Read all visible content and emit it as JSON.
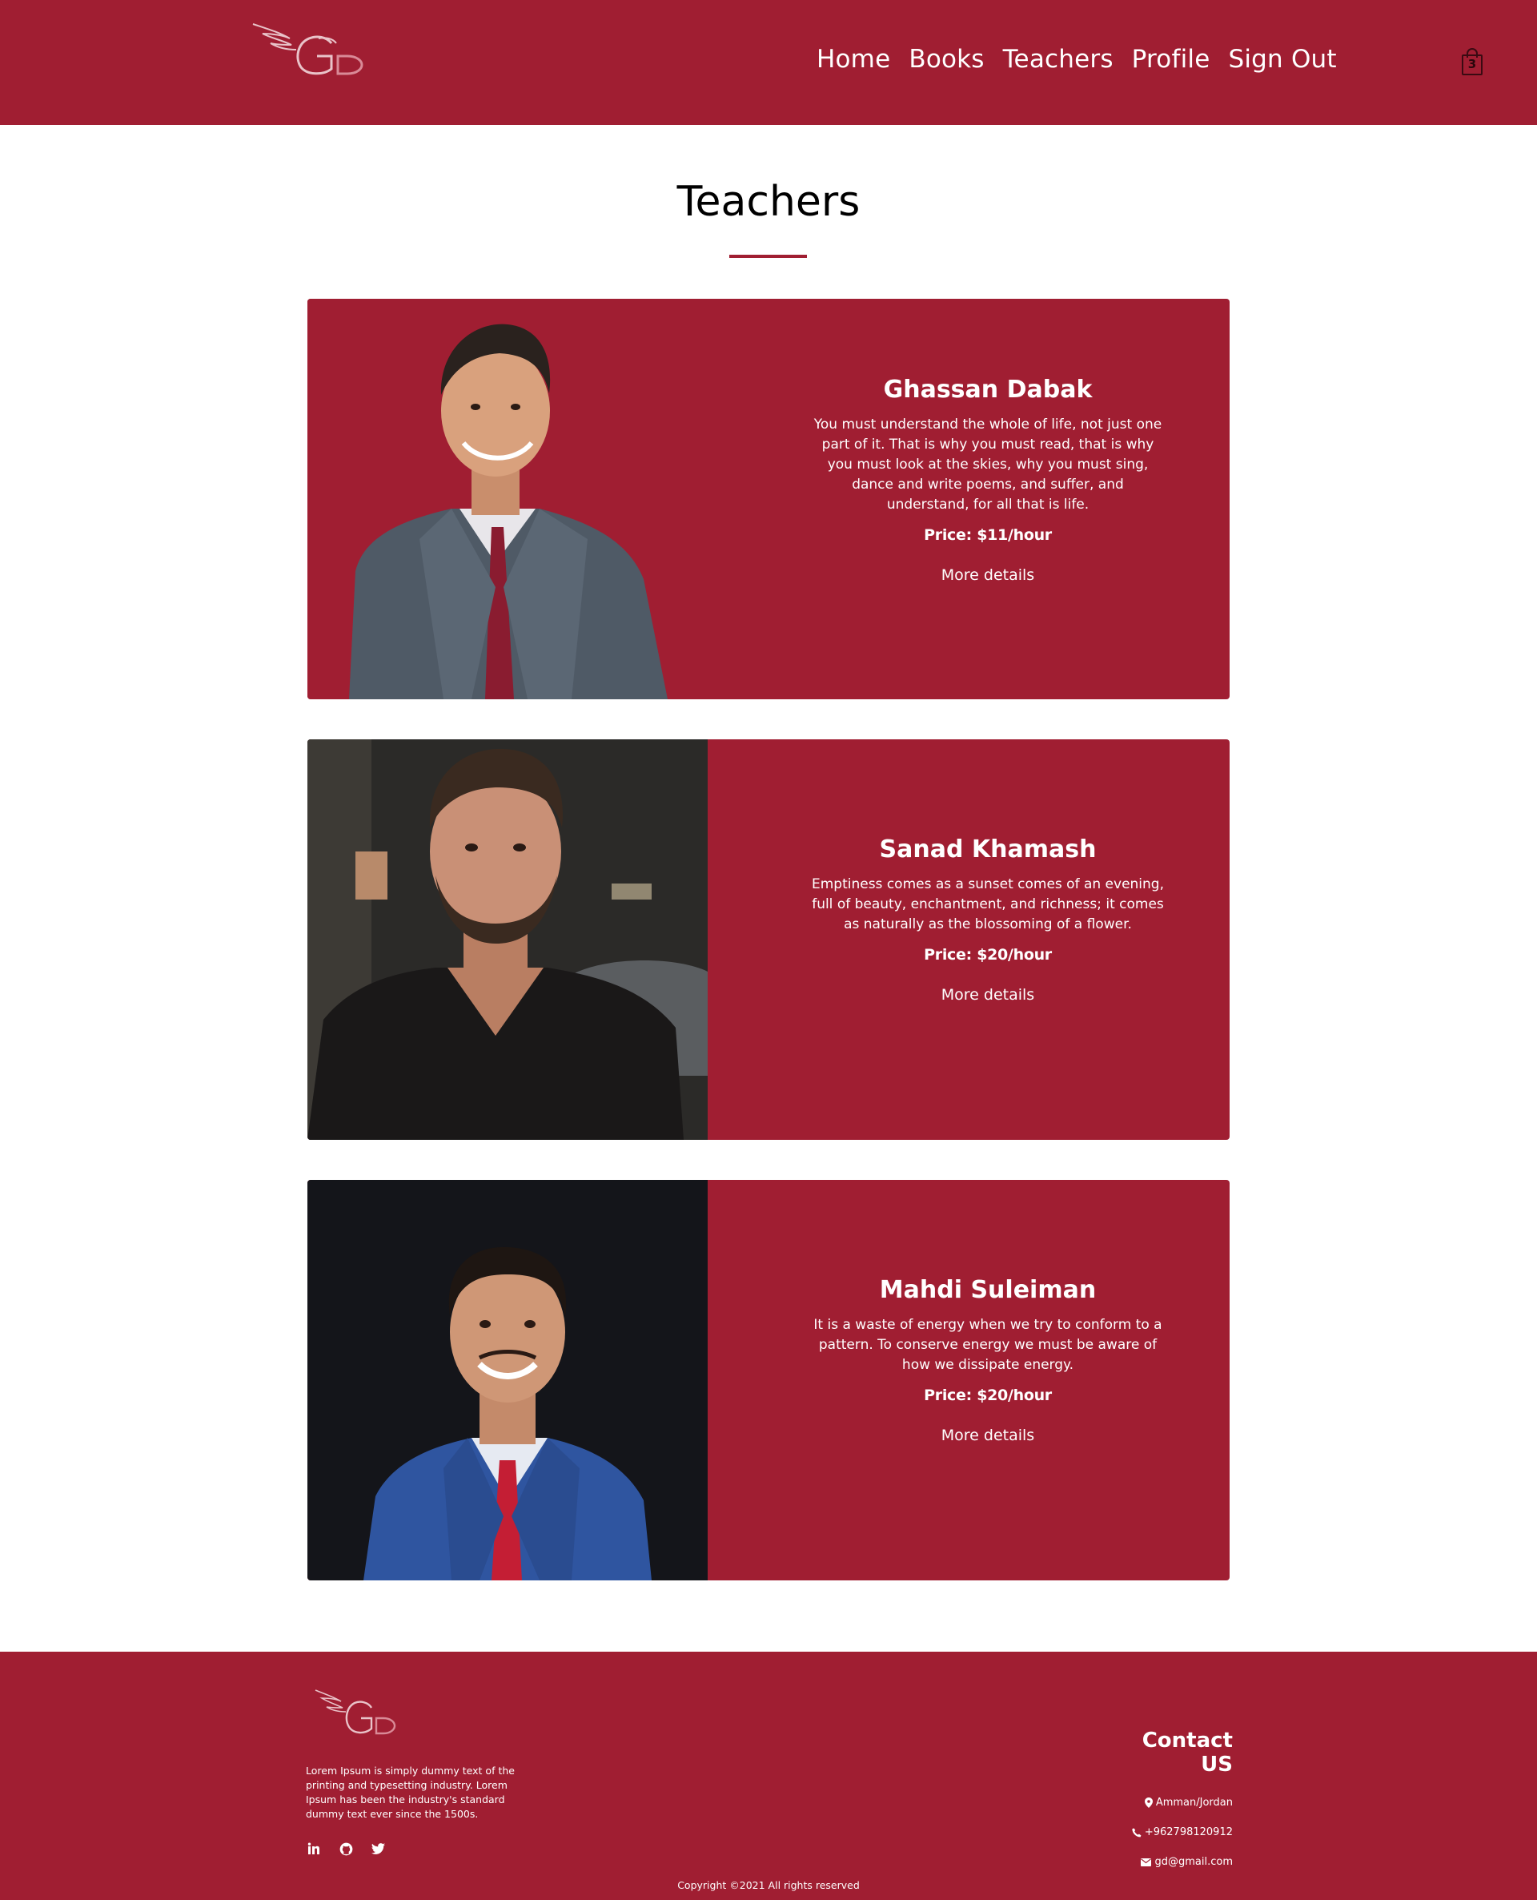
{
  "nav": {
    "links": [
      "Home",
      "Books",
      "Teachers",
      "Profile",
      "Sign Out"
    ],
    "cart_count": "3",
    "logo_icon": "gd-winged-logo"
  },
  "page": {
    "title": "Teachers"
  },
  "teachers": [
    {
      "name": "Ghassan Dabak",
      "quote": "You must understand the whole of life, not just one part of it. That is why you must read, that is why you must look at the skies, why you must sing, dance and write poems, and suffer, and understand, for all that is life.",
      "price": "Price: $11/hour",
      "more": "More details"
    },
    {
      "name": "Sanad Khamash",
      "quote": "Emptiness comes as a sunset comes of an evening, full of beauty, enchantment, and richness; it comes as naturally as the blossoming of a flower.",
      "price": "Price: $20/hour",
      "more": "More details"
    },
    {
      "name": "Mahdi Suleiman",
      "quote": "It is a waste of energy when we try to conform to a pattern. To conserve energy we must be aware of how we dissipate energy.",
      "price": "Price: $20/hour",
      "more": "More details"
    }
  ],
  "footer": {
    "about": "Lorem Ipsum is simply dummy text of the printing and typesetting industry. Lorem Ipsum has been the industry's standard dummy text ever since the 1500s.",
    "social": [
      "linkedin-icon",
      "github-icon",
      "twitter-icon"
    ],
    "contact_title": "Contact US",
    "location": "Amman/Jordan",
    "phone": "+962798120912",
    "email": "gd@gmail.com",
    "copyright": "Copyright ©2021 All rights reserved"
  },
  "colors": {
    "brand": "#a01e32",
    "white": "#ffffff"
  }
}
